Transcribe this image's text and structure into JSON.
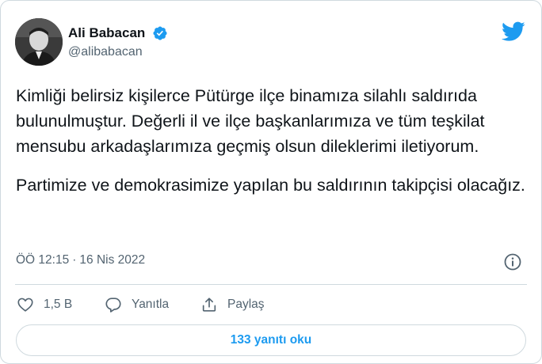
{
  "author": {
    "name": "Ali Babacan",
    "handle": "@alibabacan",
    "verified": true
  },
  "tweet": {
    "paragraphs": [
      "Kimliği belirsiz kişilerce Pütürge ilçe binamıza silahlı saldırıda bulunulmuştur. Değerli il ve ilçe başkanlarımıza ve tüm teşkilat mensubu arkadaşlarımıza geçmiş olsun dileklerimi iletiyorum.",
      "Partimize ve demokrasimize yapılan bu saldırının takipçisi olacağız."
    ],
    "time": "ÖÖ 12:15",
    "separator": "·",
    "date": "16 Nis 2022"
  },
  "actions": {
    "like_count": "1,5 B",
    "reply_label": "Yanıtla",
    "share_label": "Paylaş"
  },
  "read_replies_label": "133 yanıtı oku",
  "icons": {
    "brand": "twitter-bird-icon",
    "verified": "verified-badge-icon",
    "info": "info-icon",
    "like": "heart-icon",
    "reply": "speech-bubble-icon",
    "share": "share-icon"
  },
  "colors": {
    "brand_blue": "#1d9bf0",
    "text": "#0f1419",
    "muted": "#536471",
    "border": "#cfd9de"
  }
}
